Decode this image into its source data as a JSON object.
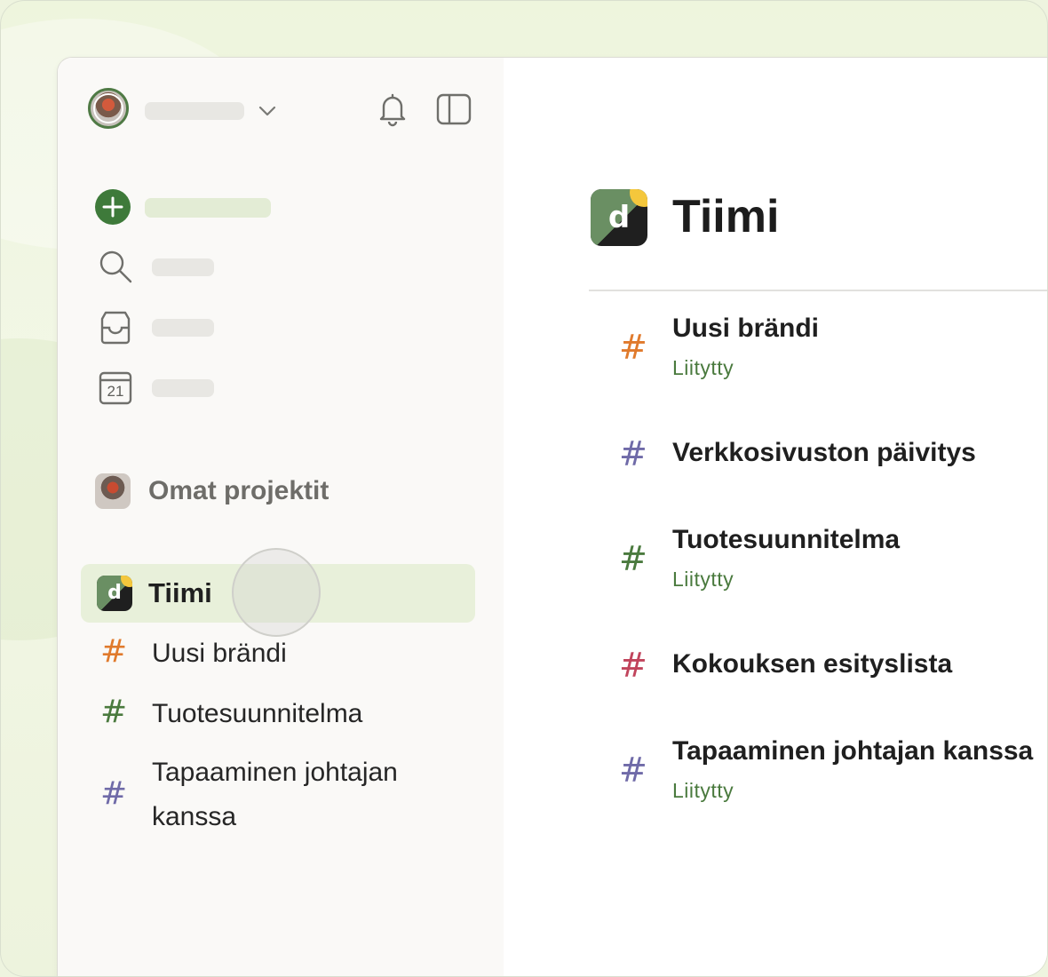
{
  "sidebar": {
    "section_title": "Omat projektit",
    "team": {
      "label": "Tiimi",
      "logo_letter": "d"
    },
    "projects": [
      {
        "label": "Uusi brändi",
        "color": "#e07a2c"
      },
      {
        "label": "Tuotesuunnitelma",
        "color": "#4a7a3e"
      },
      {
        "label_line1": "Tapaaminen johtajan",
        "label_line2": "kanssa",
        "color": "#6f6aa8"
      }
    ],
    "calendar_day": "21"
  },
  "main": {
    "title": "Tiimi",
    "logo_letter": "d",
    "projects": [
      {
        "title": "Uusi brändi",
        "status": "Liitytty",
        "color": "#e07a2c"
      },
      {
        "title": "Verkkosivuston päivitys",
        "status": "",
        "color": "#6f6aa8"
      },
      {
        "title": "Tuotesuunnitelma",
        "status": "Liitytty",
        "color": "#4a7a3e"
      },
      {
        "title": "Kokouksen esityslista",
        "status": "",
        "color": "#c1445c"
      },
      {
        "title": "Tapaaminen johtajan kanssa",
        "status": "Liitytty",
        "color": "#6f6aa8"
      }
    ]
  },
  "colors": {
    "accent_green": "#3e7a3a",
    "selected_bg": "#e8f0da",
    "status_green": "#4a7a3e"
  }
}
